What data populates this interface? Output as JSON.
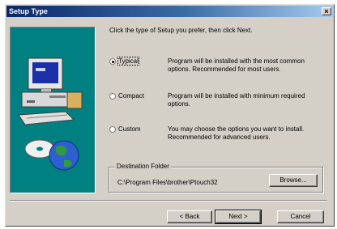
{
  "window": {
    "title": "Setup Type",
    "close_label": "×"
  },
  "instruction": "Click the type of Setup you prefer, then click Next.",
  "options": [
    {
      "label": "Typical",
      "description": "Program will be installed with the most common options. Recommended for most users.",
      "selected": true
    },
    {
      "label": "Compact",
      "description": "Program will be installed with minimum required options.",
      "selected": false
    },
    {
      "label": "Custom",
      "description": "You may choose the options you want to install. Recommended for advanced users.",
      "selected": false
    }
  ],
  "destination": {
    "title": "Destination Folder",
    "path": "C:\\Program Files\\brother\\Ptouch32",
    "browse_label": "Browse..."
  },
  "buttons": {
    "back": "< Back",
    "next": "Next >",
    "cancel": "Cancel"
  },
  "colors": {
    "art_background": "#008080",
    "titlebar": "#0a246a",
    "face": "#d4d0c8"
  }
}
